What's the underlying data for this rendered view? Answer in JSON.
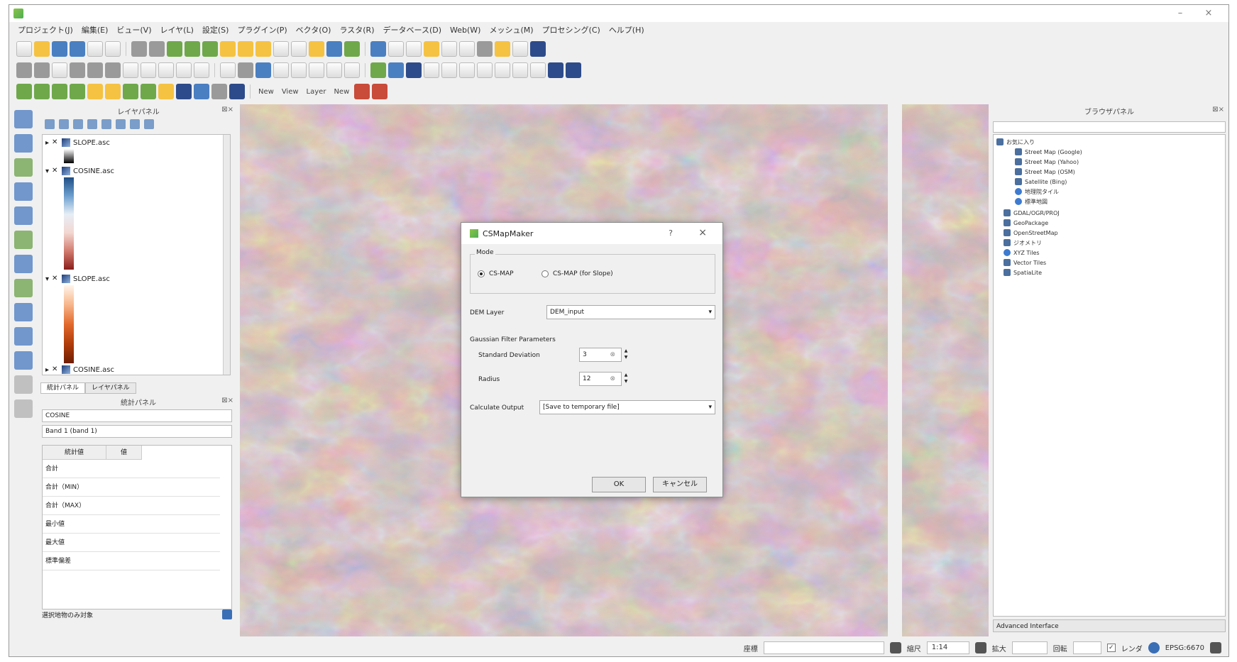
{
  "window": {
    "title": "",
    "controls": [
      "–",
      "×"
    ]
  },
  "menubar": {
    "items": [
      "プロジェクト(J)",
      "編集(E)",
      "ビュー(V)",
      "レイヤ(L)",
      "設定(S)",
      "プラグイン(P)",
      "ベクタ(O)",
      "ラスタ(R)",
      "データベース(D)",
      "Web(W)",
      "メッシュ(M)",
      "プロセシング(C)",
      "ヘルプ(H)"
    ]
  },
  "toolbar3": {
    "label_new": "New",
    "label_view": "View",
    "label_layer": "Layer",
    "label_new2": "New"
  },
  "layers_panel": {
    "title": "レイヤパネル",
    "layers": [
      {
        "name": "SLOPE.asc"
      },
      {
        "name": "COSINE.asc"
      },
      {
        "name": "SLOPE.asc"
      },
      {
        "name": "COSINE.asc"
      }
    ],
    "tabs": [
      "統計パネル",
      "レイヤパネル"
    ]
  },
  "stats_panel": {
    "title": "統計パネル",
    "layer_value": "COSINE",
    "field_value": "Band 1 (band 1)",
    "headers": [
      "統計値",
      "値"
    ],
    "rows": [
      "合計",
      "合計（MIN）",
      "合計（MAX）",
      "最小値",
      "最大値",
      "標準偏差"
    ],
    "bottom_label": "選択地物のみ対象"
  },
  "dialog": {
    "title": "CSMapMaker",
    "mode_label": "Mode",
    "radio_options": [
      "CS-MAP",
      "CS-MAP (for Slope)"
    ],
    "dem_label": "DEM Layer",
    "dem_value": "DEM_input",
    "section_label": "Gaussian Filter Parameters",
    "sd_label": "Standard Deviation",
    "sd_value": "3",
    "radius_label": "Radius",
    "radius_value": "12",
    "output_label": "Calculate Output",
    "output_value": "[Save to temporary file]",
    "ok_label": "OK",
    "cancel_label": "キャンセル"
  },
  "right_panel": {
    "title": "ブラウザパネル",
    "tree": [
      "お気に入り",
      "Street Map (Google)",
      "Street Map (Yahoo)",
      "Street Map (OSM)",
      "Satellite (Bing)",
      "地理院タイル",
      "標準地図",
      "GDAL/OGR/PROJ",
      "GeoPackage",
      "OpenStreetMap",
      "ジオメトリ",
      "XYZ Tiles",
      "Vector Tiles",
      "SpatiaLite"
    ],
    "bottom_label": "Advanced Interface"
  },
  "statusbar": {
    "coord_label": "座標",
    "coord_value": "",
    "scale_label": "縮尺",
    "scale_value": "1:14",
    "magnifier_label": "拡大",
    "rotation_label": "回転",
    "render_label": "レンダ",
    "crs_label": "EPSG:6670"
  }
}
